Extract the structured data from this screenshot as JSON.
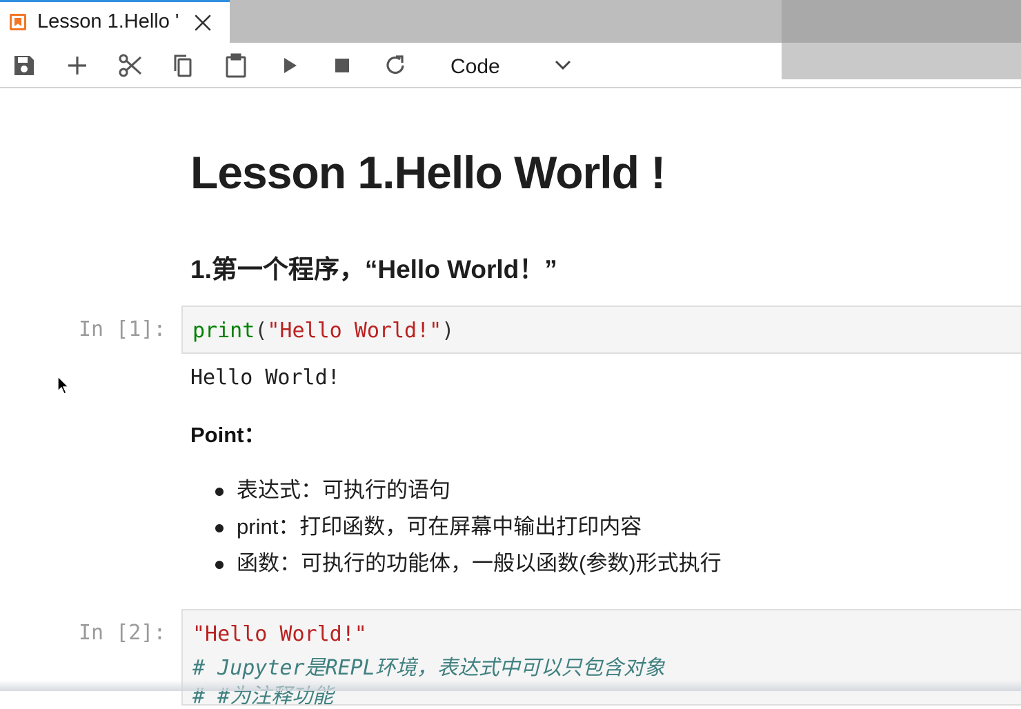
{
  "tab": {
    "title": "Lesson 1.Hello '"
  },
  "toolbar": {
    "buttons": [
      "save-icon",
      "add-icon",
      "cut-icon",
      "copy-icon",
      "paste-icon",
      "run-icon",
      "stop-icon",
      "restart-icon"
    ],
    "cell_type": "Code"
  },
  "notebook": {
    "title": "Lesson 1.Hello World !",
    "heading": "1.第一个程序，“Hello World！”",
    "cell1": {
      "prompt": "In [1]:",
      "code": {
        "func": "print",
        "open": "(",
        "string": "\"Hello World!\"",
        "close": ")"
      },
      "output": "Hello World!"
    },
    "point_label": "Point：",
    "bullets": [
      "表达式：可执行的语句",
      "print：打印函数，可在屏幕中输出打印内容",
      "函数：可执行的功能体，一般以函数(参数)形式执行"
    ],
    "cell2": {
      "prompt": "In [2]:",
      "line1": "\"Hello World!\"",
      "line2": "# Jupyter是REPL环境，表达式中可以只包含对象",
      "line3": "# #为注释功能"
    }
  },
  "colors": {
    "tab_accent": "#2f8ee0",
    "jupyter_orange": "#f37626",
    "string": "#ba2121",
    "builtin": "#008000",
    "comment": "#408080"
  }
}
